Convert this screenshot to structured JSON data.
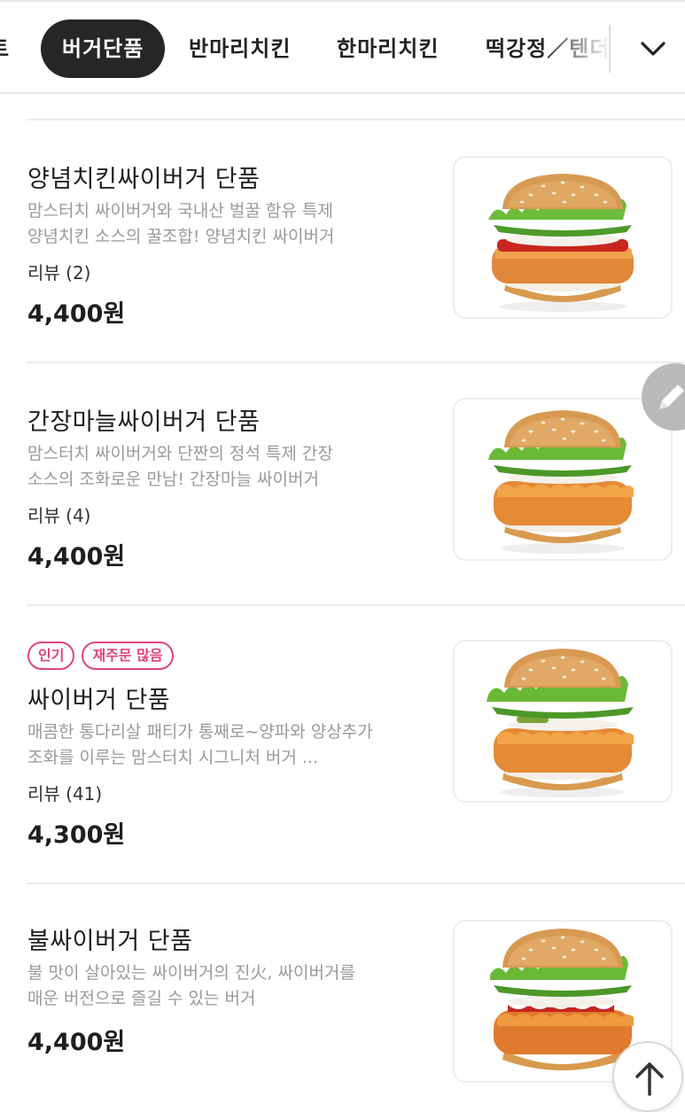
{
  "tabs": [
    {
      "label": "트",
      "active": false
    },
    {
      "label": "버거단품",
      "active": true
    },
    {
      "label": "반마리치킨",
      "active": false
    },
    {
      "label": "한마리치킨",
      "active": false
    },
    {
      "label": "떡강정／텐더",
      "active": false
    }
  ],
  "colors": {
    "active_tab_bg": "#262626",
    "badge_pink": "#e0447a",
    "description_gray": "#9a9a9a"
  },
  "icons": {
    "expand": "chevron-down-icon",
    "edit": "pencil-icon",
    "scroll_top": "arrow-up-icon"
  },
  "items": [
    {
      "name": "양념치킨싸이버거 단품",
      "desc_line1": "맘스터치 싸이버거와 국내산 벌꿀 함유 특제",
      "desc_line2": "양념치킨 소스의 꿀조합! 양념치킨 싸이버거",
      "review": "리뷰 (2)",
      "price": "4,400",
      "currency": "원",
      "badges": []
    },
    {
      "name": "간장마늘싸이버거 단품",
      "desc_line1": "맘스터치 싸이버거와 단짠의 정석 특제 간장",
      "desc_line2": "소스의 조화로운 만남! 간장마늘 싸이버거",
      "review": "리뷰 (4)",
      "price": "4,400",
      "currency": "원",
      "badges": []
    },
    {
      "name": "싸이버거 단품",
      "desc_line1": "매콤한 통다리살 패티가 통째로~양파와 양상추가",
      "desc_line2": "조화를 이루는 맘스터치 시그니처 버거 ...",
      "review": "리뷰 (41)",
      "price": "4,300",
      "currency": "원",
      "badges": [
        "인기",
        "재주문 많음"
      ]
    },
    {
      "name": "불싸이버거 단품",
      "desc_line1": "불 맛이 살아있는 싸이버거의 진火, 싸이버거를",
      "desc_line2": "매운 버전으로 즐길 수 있는 버거",
      "price": "4,400",
      "currency": "원",
      "badges": []
    }
  ]
}
